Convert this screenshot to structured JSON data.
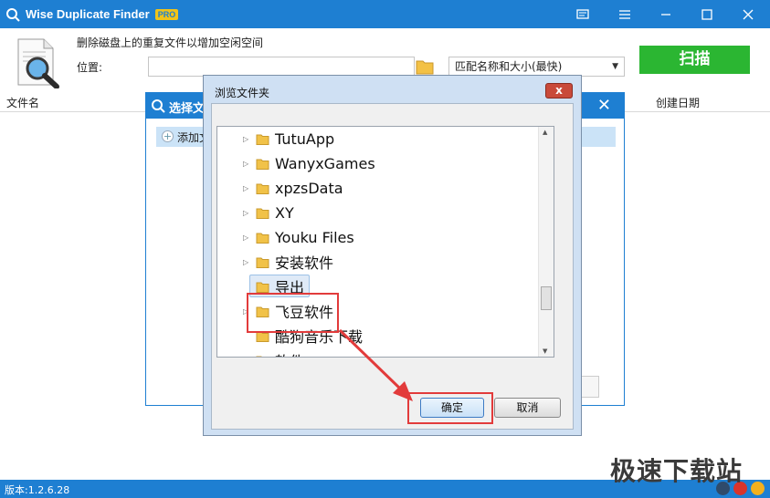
{
  "app": {
    "title": "Wise Duplicate Finder",
    "badge": "PRO",
    "subtitle": "删除磁盘上的重复文件以增加空闲空间",
    "location_label": "位置:",
    "location_value": "",
    "match_mode": "匹配名称和大小(最快)",
    "scan_label": "扫描"
  },
  "columns": {
    "filename": "文件名",
    "created": "创建日期"
  },
  "select_dialog": {
    "title": "选择文",
    "add_folder": "添加文"
  },
  "browse_dialog": {
    "title": "浏览文件夹",
    "close_label": "x",
    "ok_label": "确定",
    "cancel_label": "取消",
    "items": [
      {
        "label": "TutuApp",
        "expandable": true,
        "selected": false
      },
      {
        "label": "WanyxGames",
        "expandable": true,
        "selected": false
      },
      {
        "label": "xpzsData",
        "expandable": true,
        "selected": false
      },
      {
        "label": "XY",
        "expandable": true,
        "selected": false
      },
      {
        "label": "Youku Files",
        "expandable": true,
        "selected": false
      },
      {
        "label": "安装软件",
        "expandable": true,
        "selected": false
      },
      {
        "label": "导出",
        "expandable": false,
        "selected": true
      },
      {
        "label": "飞豆软件",
        "expandable": true,
        "selected": false
      },
      {
        "label": "酷狗音乐下载",
        "expandable": false,
        "selected": false
      },
      {
        "label": "软件",
        "expandable": true,
        "selected": false
      }
    ]
  },
  "status": {
    "version": "版本:1.2.6.28"
  },
  "watermark": "极速下载站",
  "colors": {
    "title_bar": "#1e7fd2",
    "scan_button": "#2bb632",
    "annotation": "#e23b3b"
  }
}
